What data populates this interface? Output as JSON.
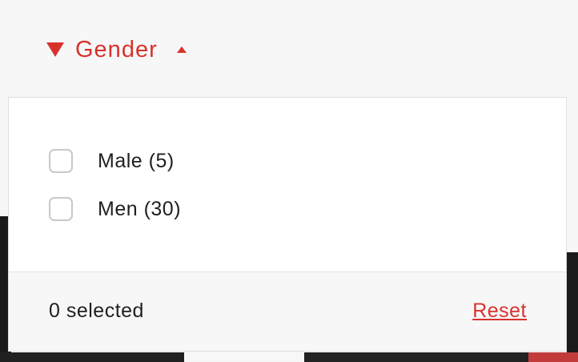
{
  "filter": {
    "title": "Gender",
    "expanded": true,
    "accent_color": "#d8322c",
    "icons": {
      "leading": "triangle-down-icon",
      "trailing": "caret-up-icon"
    }
  },
  "options": [
    {
      "label": "Male (5)",
      "checked": false
    },
    {
      "label": "Men (30)",
      "checked": false
    }
  ],
  "footer": {
    "selected_text": "0 selected",
    "reset_label": "Reset"
  }
}
